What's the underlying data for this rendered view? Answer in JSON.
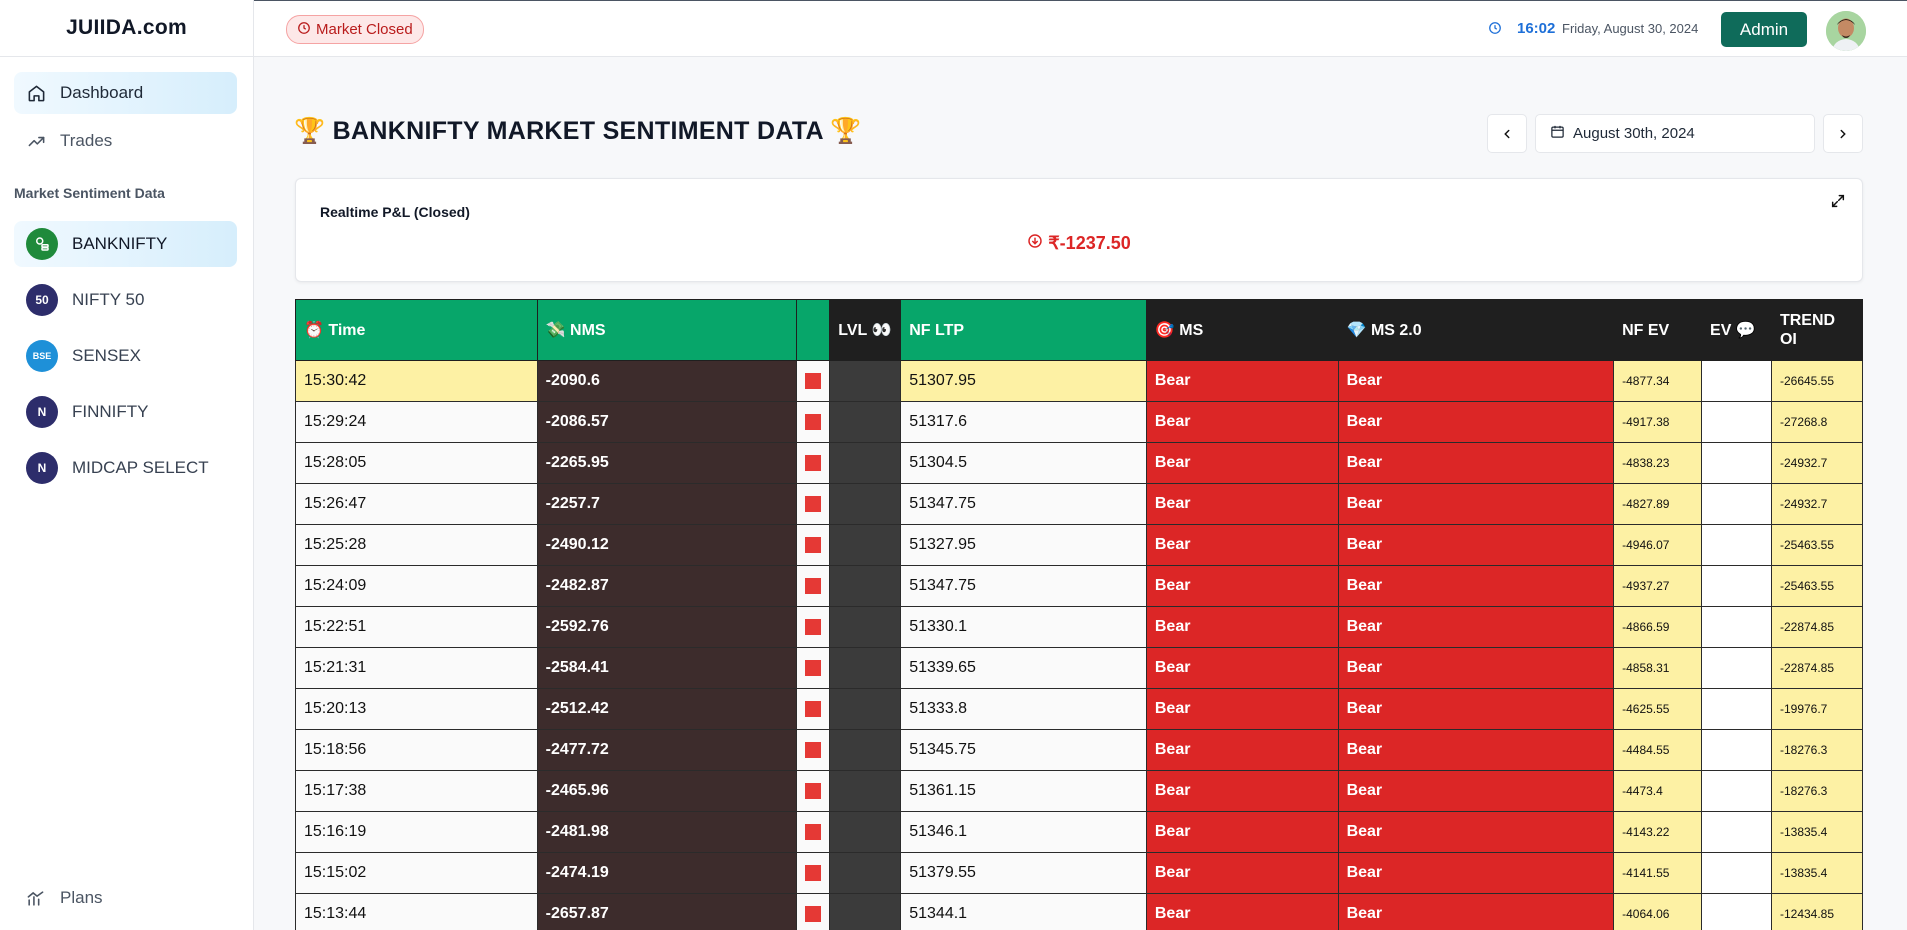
{
  "brand": "JUIIDA.com",
  "nav": {
    "dashboard": "Dashboard",
    "trades": "Trades",
    "section_label": "Market Sentiment Data",
    "plans": "Plans"
  },
  "indices": [
    {
      "label": "BANKNIFTY",
      "logo_text": "",
      "color": "#1f8a3b"
    },
    {
      "label": "NIFTY 50",
      "logo_text": "50",
      "color": "#2d2d6b"
    },
    {
      "label": "SENSEX",
      "logo_text": "BSE",
      "color": "#1e90d8"
    },
    {
      "label": "FINNIFTY",
      "logo_text": "N",
      "color": "#2d2d6b"
    },
    {
      "label": "MIDCAP SELECT",
      "logo_text": "N",
      "color": "#2d2d6b"
    }
  ],
  "topbar": {
    "market_status": "Market Closed",
    "time": "16:02",
    "date": "Friday, August 30, 2024",
    "admin_label": "Admin"
  },
  "page": {
    "title": "🏆 BANKNIFTY MARKET SENTIMENT DATA 🏆",
    "selected_date": "August 30th, 2024"
  },
  "pnl": {
    "title": "Realtime P&L (Closed)",
    "value": "₹-1237.50"
  },
  "table": {
    "headers": {
      "time": "⏰ Time",
      "nms": "💸 NMS",
      "lvl": "LVL 👀",
      "nf_ltp": "NF LTP",
      "ms": "🎯 MS",
      "ms2": "💎 MS 2.0",
      "nf_ev": "NF EV",
      "ev": "EV 💬",
      "trend_oi": "TREND OI"
    },
    "rows": [
      {
        "time": "15:30:42",
        "nms": "-2090.6",
        "nf_ltp": "51307.95",
        "ms": "Bear",
        "ms2": "Bear",
        "nf_ev": "-4877.34",
        "trend_oi": "-26645.55"
      },
      {
        "time": "15:29:24",
        "nms": "-2086.57",
        "nf_ltp": "51317.6",
        "ms": "Bear",
        "ms2": "Bear",
        "nf_ev": "-4917.38",
        "trend_oi": "-27268.8"
      },
      {
        "time": "15:28:05",
        "nms": "-2265.95",
        "nf_ltp": "51304.5",
        "ms": "Bear",
        "ms2": "Bear",
        "nf_ev": "-4838.23",
        "trend_oi": "-24932.7"
      },
      {
        "time": "15:26:47",
        "nms": "-2257.7",
        "nf_ltp": "51347.75",
        "ms": "Bear",
        "ms2": "Bear",
        "nf_ev": "-4827.89",
        "trend_oi": "-24932.7"
      },
      {
        "time": "15:25:28",
        "nms": "-2490.12",
        "nf_ltp": "51327.95",
        "ms": "Bear",
        "ms2": "Bear",
        "nf_ev": "-4946.07",
        "trend_oi": "-25463.55"
      },
      {
        "time": "15:24:09",
        "nms": "-2482.87",
        "nf_ltp": "51347.75",
        "ms": "Bear",
        "ms2": "Bear",
        "nf_ev": "-4937.27",
        "trend_oi": "-25463.55"
      },
      {
        "time": "15:22:51",
        "nms": "-2592.76",
        "nf_ltp": "51330.1",
        "ms": "Bear",
        "ms2": "Bear",
        "nf_ev": "-4866.59",
        "trend_oi": "-22874.85"
      },
      {
        "time": "15:21:31",
        "nms": "-2584.41",
        "nf_ltp": "51339.65",
        "ms": "Bear",
        "ms2": "Bear",
        "nf_ev": "-4858.31",
        "trend_oi": "-22874.85"
      },
      {
        "time": "15:20:13",
        "nms": "-2512.42",
        "nf_ltp": "51333.8",
        "ms": "Bear",
        "ms2": "Bear",
        "nf_ev": "-4625.55",
        "trend_oi": "-19976.7"
      },
      {
        "time": "15:18:56",
        "nms": "-2477.72",
        "nf_ltp": "51345.75",
        "ms": "Bear",
        "ms2": "Bear",
        "nf_ev": "-4484.55",
        "trend_oi": "-18276.3"
      },
      {
        "time": "15:17:38",
        "nms": "-2465.96",
        "nf_ltp": "51361.15",
        "ms": "Bear",
        "ms2": "Bear",
        "nf_ev": "-4473.4",
        "trend_oi": "-18276.3"
      },
      {
        "time": "15:16:19",
        "nms": "-2481.98",
        "nf_ltp": "51346.1",
        "ms": "Bear",
        "ms2": "Bear",
        "nf_ev": "-4143.22",
        "trend_oi": "-13835.4"
      },
      {
        "time": "15:15:02",
        "nms": "-2474.19",
        "nf_ltp": "51379.55",
        "ms": "Bear",
        "ms2": "Bear",
        "nf_ev": "-4141.55",
        "trend_oi": "-13835.4"
      },
      {
        "time": "15:13:44",
        "nms": "-2657.87",
        "nf_ltp": "51344.1",
        "ms": "Bear",
        "ms2": "Bear",
        "nf_ev": "-4064.06",
        "trend_oi": "-12434.85"
      }
    ]
  },
  "colors": {
    "accent_green": "#07a66a",
    "bear_red": "#dc2626",
    "admin_button": "#0f6b5a",
    "highlight_yellow": "#fdf1a4"
  }
}
